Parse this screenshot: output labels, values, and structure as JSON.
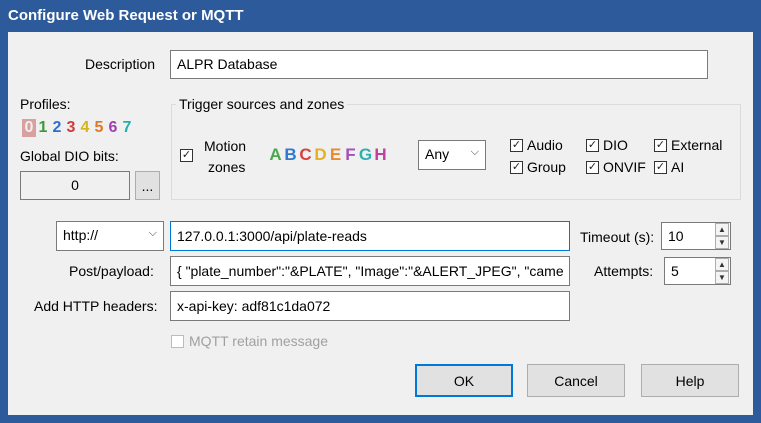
{
  "window": {
    "title": "Configure Web Request or MQTT"
  },
  "description": {
    "label": "Description",
    "value": "ALPR Database"
  },
  "profiles": {
    "label": "Profiles:",
    "digits": [
      {
        "ch": "0",
        "color": "#a0a0a0"
      },
      {
        "ch": "1",
        "color": "#3a9a3a"
      },
      {
        "ch": "2",
        "color": "#2a6fd6"
      },
      {
        "ch": "3",
        "color": "#d23a3a"
      },
      {
        "ch": "4",
        "color": "#d6b41a"
      },
      {
        "ch": "5",
        "color": "#e07820"
      },
      {
        "ch": "6",
        "color": "#a040b0"
      },
      {
        "ch": "7",
        "color": "#20b0b0"
      }
    ]
  },
  "global_dio": {
    "label": "Global DIO bits:",
    "value": "0",
    "browse_label": "..."
  },
  "trigger": {
    "title": "Trigger sources and zones",
    "motion_label_1": "Motion",
    "motion_label_2": "zones",
    "zones": [
      {
        "ch": "A",
        "color": "#4aa84a"
      },
      {
        "ch": "B",
        "color": "#2f78d0"
      },
      {
        "ch": "C",
        "color": "#d84040"
      },
      {
        "ch": "D",
        "color": "#e8b020"
      },
      {
        "ch": "E",
        "color": "#e88a30"
      },
      {
        "ch": "F",
        "color": "#a050b8"
      },
      {
        "ch": "G",
        "color": "#30b0b0"
      },
      {
        "ch": "H",
        "color": "#c040a0"
      }
    ],
    "any_value": "Any",
    "audio": "Audio",
    "dio": "DIO",
    "external": "External",
    "group": "Group",
    "onvif": "ONVIF",
    "ai": "AI"
  },
  "request": {
    "protocol": "http://",
    "url": "127.0.0.1:3000/api/plate-reads",
    "timeout_label": "Timeout (s):",
    "timeout_value": "10",
    "payload_label": "Post/payload:",
    "payload_value": "{ \"plate_number\":\"&PLATE\", \"Image\":\"&ALERT_JPEG\", \"came",
    "attempts_label": "Attempts:",
    "attempts_value": "5",
    "headers_label": "Add HTTP headers:",
    "headers_value": "x-api-key: adf81c1da072",
    "mqtt_retain": "MQTT retain message"
  },
  "buttons": {
    "ok": "OK",
    "cancel": "Cancel",
    "help": "Help"
  },
  "colors": {
    "title_bar": "#2c5a9b",
    "focus": "#0078d7"
  }
}
